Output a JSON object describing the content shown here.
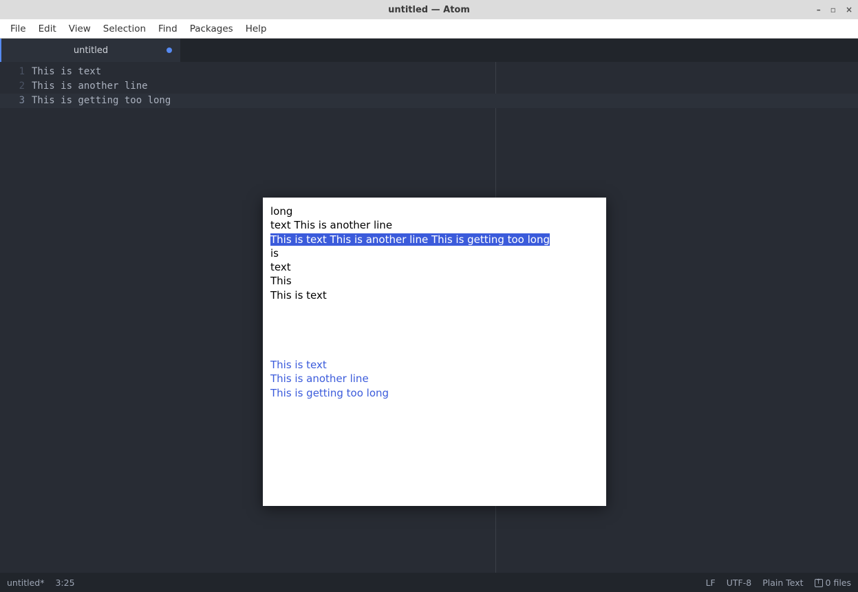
{
  "window": {
    "title": "untitled — Atom"
  },
  "menu": {
    "file": "File",
    "edit": "Edit",
    "view": "View",
    "selection": "Selection",
    "find": "Find",
    "packages": "Packages",
    "help": "Help"
  },
  "tab": {
    "title": "untitled"
  },
  "editor": {
    "lines": [
      {
        "num": "1",
        "text": "This is text"
      },
      {
        "num": "2",
        "text": "This is another line"
      },
      {
        "num": "3",
        "text": "This is getting too long"
      }
    ],
    "active_line_index": 2
  },
  "popup": {
    "items_top": [
      "long",
      "text This is another line"
    ],
    "selected": "This is text This is another line This is getting too long",
    "items_mid": [
      "is",
      "text",
      "This",
      "This is text"
    ],
    "items_link": [
      "This is text",
      "This is another line",
      "This is getting too long"
    ]
  },
  "status": {
    "filename": "untitled*",
    "cursor": "3:25",
    "line_ending": "LF",
    "encoding": "UTF-8",
    "grammar": "Plain Text",
    "git": "0 files"
  }
}
